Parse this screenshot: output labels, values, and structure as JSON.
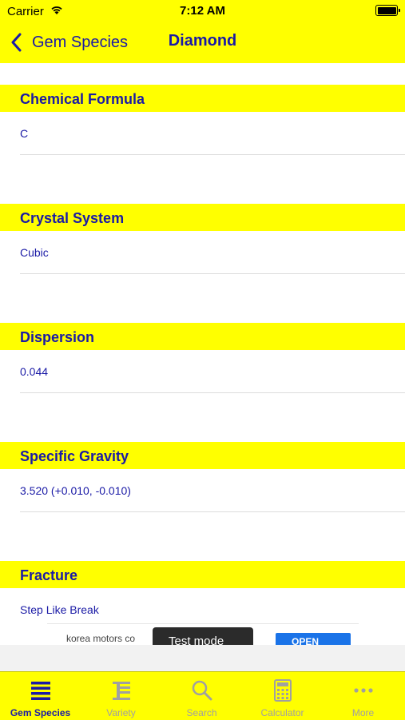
{
  "status_bar": {
    "carrier": "Carrier",
    "time": "7:12 AM"
  },
  "nav": {
    "back_label": "Gem Species",
    "title": "Diamond"
  },
  "sections": [
    {
      "header": "Chemical Formula",
      "value": "C"
    },
    {
      "header": "Crystal System",
      "value": "Cubic"
    },
    {
      "header": "Dispersion",
      "value": "0.044"
    },
    {
      "header": "Specific Gravity",
      "value": "3.520 (+0.010, -0.010)"
    },
    {
      "header": "Fracture",
      "value": "Step Like Break"
    }
  ],
  "ad": {
    "text": "korea motors co",
    "badge": "Test mode",
    "button": "OPEN"
  },
  "tabs": [
    {
      "label": "Gem Species",
      "icon": "list-icon",
      "active": true
    },
    {
      "label": "Variety",
      "icon": "variety-icon",
      "active": false
    },
    {
      "label": "Search",
      "icon": "search-icon",
      "active": false
    },
    {
      "label": "Calculator",
      "icon": "calculator-icon",
      "active": false
    },
    {
      "label": "More",
      "icon": "more-icon",
      "active": false
    }
  ],
  "colors": {
    "accent": "#ffff00",
    "text": "#1a1aa6",
    "inactive": "#a0a0a0"
  }
}
